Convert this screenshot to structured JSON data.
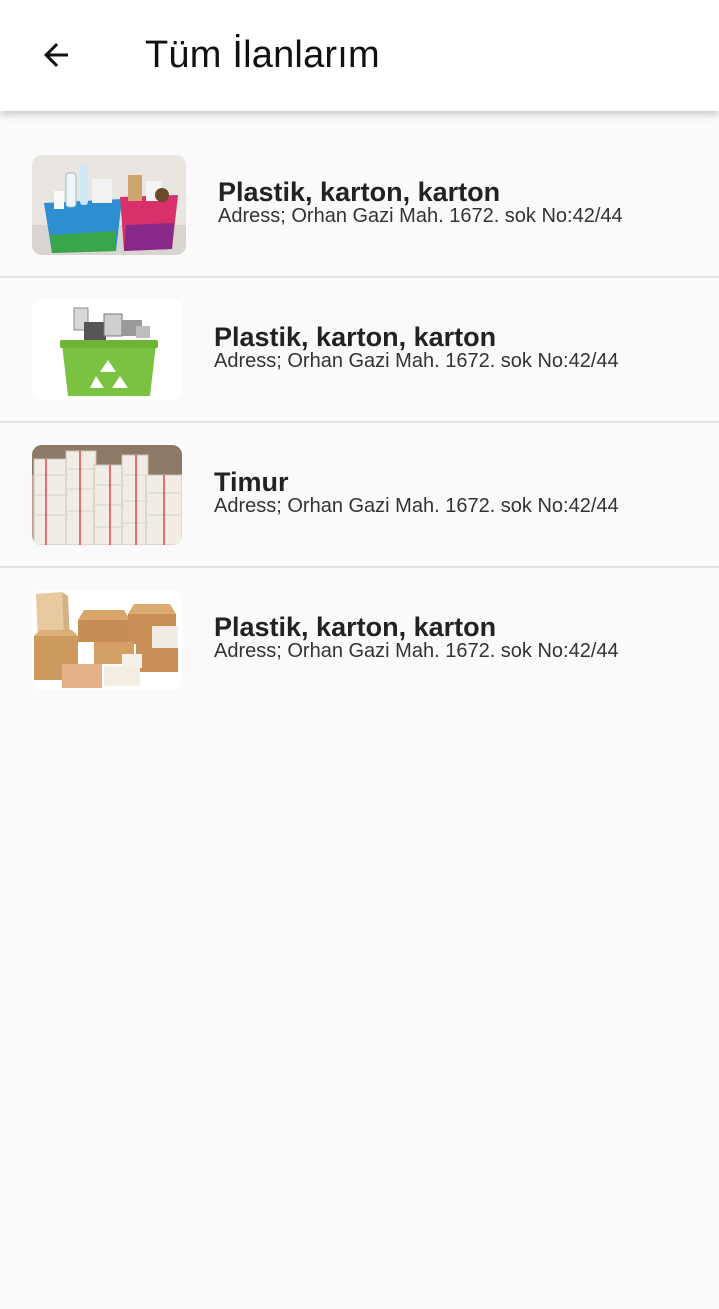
{
  "header": {
    "title": "Tüm İlanlarım",
    "back_icon": "arrow-left-icon"
  },
  "listings": [
    {
      "title": "Plastik, karton, karton",
      "address": "Adress; Orhan Gazi Mah. 1672. sok No:42/44",
      "image": "recycling-baskets-photo"
    },
    {
      "title": "Plastik, karton, karton",
      "address": "Adress; Orhan Gazi Mah. 1672. sok No:42/44",
      "image": "electronic-waste-bin-photo"
    },
    {
      "title": "Timur",
      "address": "Adress; Orhan Gazi Mah. 1672. sok No:42/44",
      "image": "newspaper-stacks-photo"
    },
    {
      "title": "Plastik, karton, karton",
      "address": "Adress; Orhan Gazi Mah. 1672. sok No:42/44",
      "image": "cardboard-boxes-photo"
    }
  ],
  "colors": {
    "appbar_bg": "#ffffff",
    "page_bg": "#fafafa",
    "divider": "#e3e3e3",
    "bin_green": "#7bc142"
  }
}
